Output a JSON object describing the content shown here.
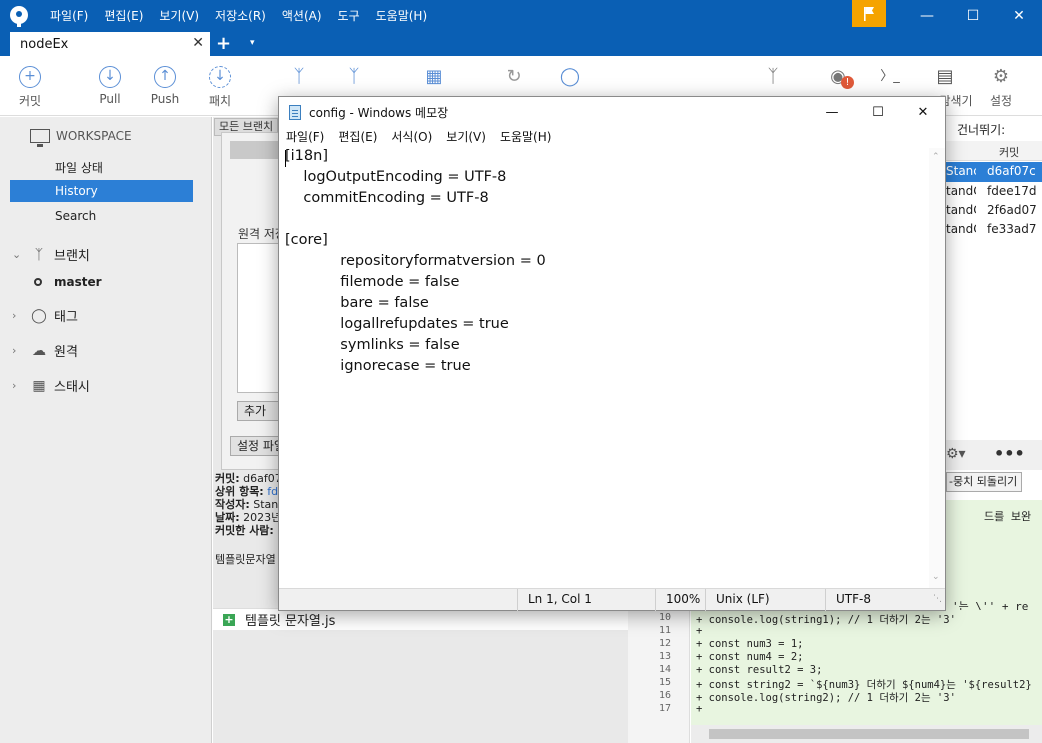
{
  "app": {
    "menu": [
      "파일(F)",
      "편집(E)",
      "보기(V)",
      "저장소(R)",
      "액션(A)",
      "도구",
      "도움말(H)"
    ],
    "tab_title": "nodeEx",
    "tab_close": "✕",
    "tab_add": "+",
    "tab_dropdown": "▾"
  },
  "toolbar": {
    "commit": "커밋",
    "pull": "Pull",
    "push": "Push",
    "fetch": "패치",
    "settings_partial": "설정",
    "explorer_partial": "탐색기"
  },
  "sidebar": {
    "workspace": "WORKSPACE",
    "file_status": "파일 상태",
    "history": "History",
    "search": "Search",
    "branches": "브랜치",
    "branch_master": "master",
    "tags": "태그",
    "remotes": "원격",
    "stashes": "스태시"
  },
  "middle": {
    "filter_partial": "모든 브랜치",
    "dialog_label": "원격 저장소",
    "dialog_add": "추가",
    "dialog_settings": "설정 파일 편집",
    "commit_info": [
      {
        "k": "커밋:",
        "v": " d6af07c"
      },
      {
        "k": "상위 항목:",
        "v": " fdee17d"
      },
      {
        "k": "작성자:",
        "v": " StandC"
      },
      {
        "k": "날짜:",
        "v": " 2023년"
      },
      {
        "k": "커밋한 사람:",
        "v": ""
      }
    ],
    "commit_message": "템플릿문자열",
    "file_name": "템플릿 문자열.js"
  },
  "history": {
    "jump": "건너뛰기:",
    "col_commit": "커밋",
    "rows": [
      {
        "author": "Stanc",
        "hash": "d6af07c"
      },
      {
        "author": "tandC",
        "hash": "fdee17d"
      },
      {
        "author": "tandC",
        "hash": "2f6ad07"
      },
      {
        "author": "tandC",
        "hash": "fe33ad7"
      }
    ]
  },
  "diff": {
    "revert_button": "-뭉치 되돌리기",
    "top_text": "드를 보완",
    "top_text2": "'는 \\'' + re",
    "line_numbers": [
      "10",
      "11",
      "12",
      "13",
      "14",
      "15",
      "16",
      "17"
    ],
    "lines": [
      "+ console.log(string1); // 1 더하기 2는 '3'",
      "+",
      "+ const num3 = 1;",
      "+ const num4 = 2;",
      "+ const result2 = 3;",
      "+ const string2 = `${num3} 더하기 ${num4}는 '${result2}",
      "+ console.log(string2); // 1 더하기 2는 '3'",
      "+"
    ]
  },
  "notepad": {
    "title": "config - Windows 메모장",
    "menu": [
      "파일(F)",
      "편집(E)",
      "서식(O)",
      "보기(V)",
      "도움말(H)"
    ],
    "content": [
      "[i18n]",
      "    logOutputEncoding = UTF-8",
      "    commitEncoding = UTF-8",
      "",
      "[core]",
      "            repositoryformatversion = 0",
      "            filemode = false",
      "            bare = false",
      "            logallrefupdates = true",
      "            symlinks = false",
      "            ignorecase = true"
    ],
    "status": {
      "position": "Ln 1, Col 1",
      "zoom": "100%",
      "line_ending": "Unix (LF)",
      "encoding": "UTF-8"
    }
  },
  "colors": {
    "titlebar": "#0a5fb4",
    "selection": "#2c7fd6",
    "flag": "#f5a300",
    "diff_added_bg": "#e8f5e0"
  }
}
